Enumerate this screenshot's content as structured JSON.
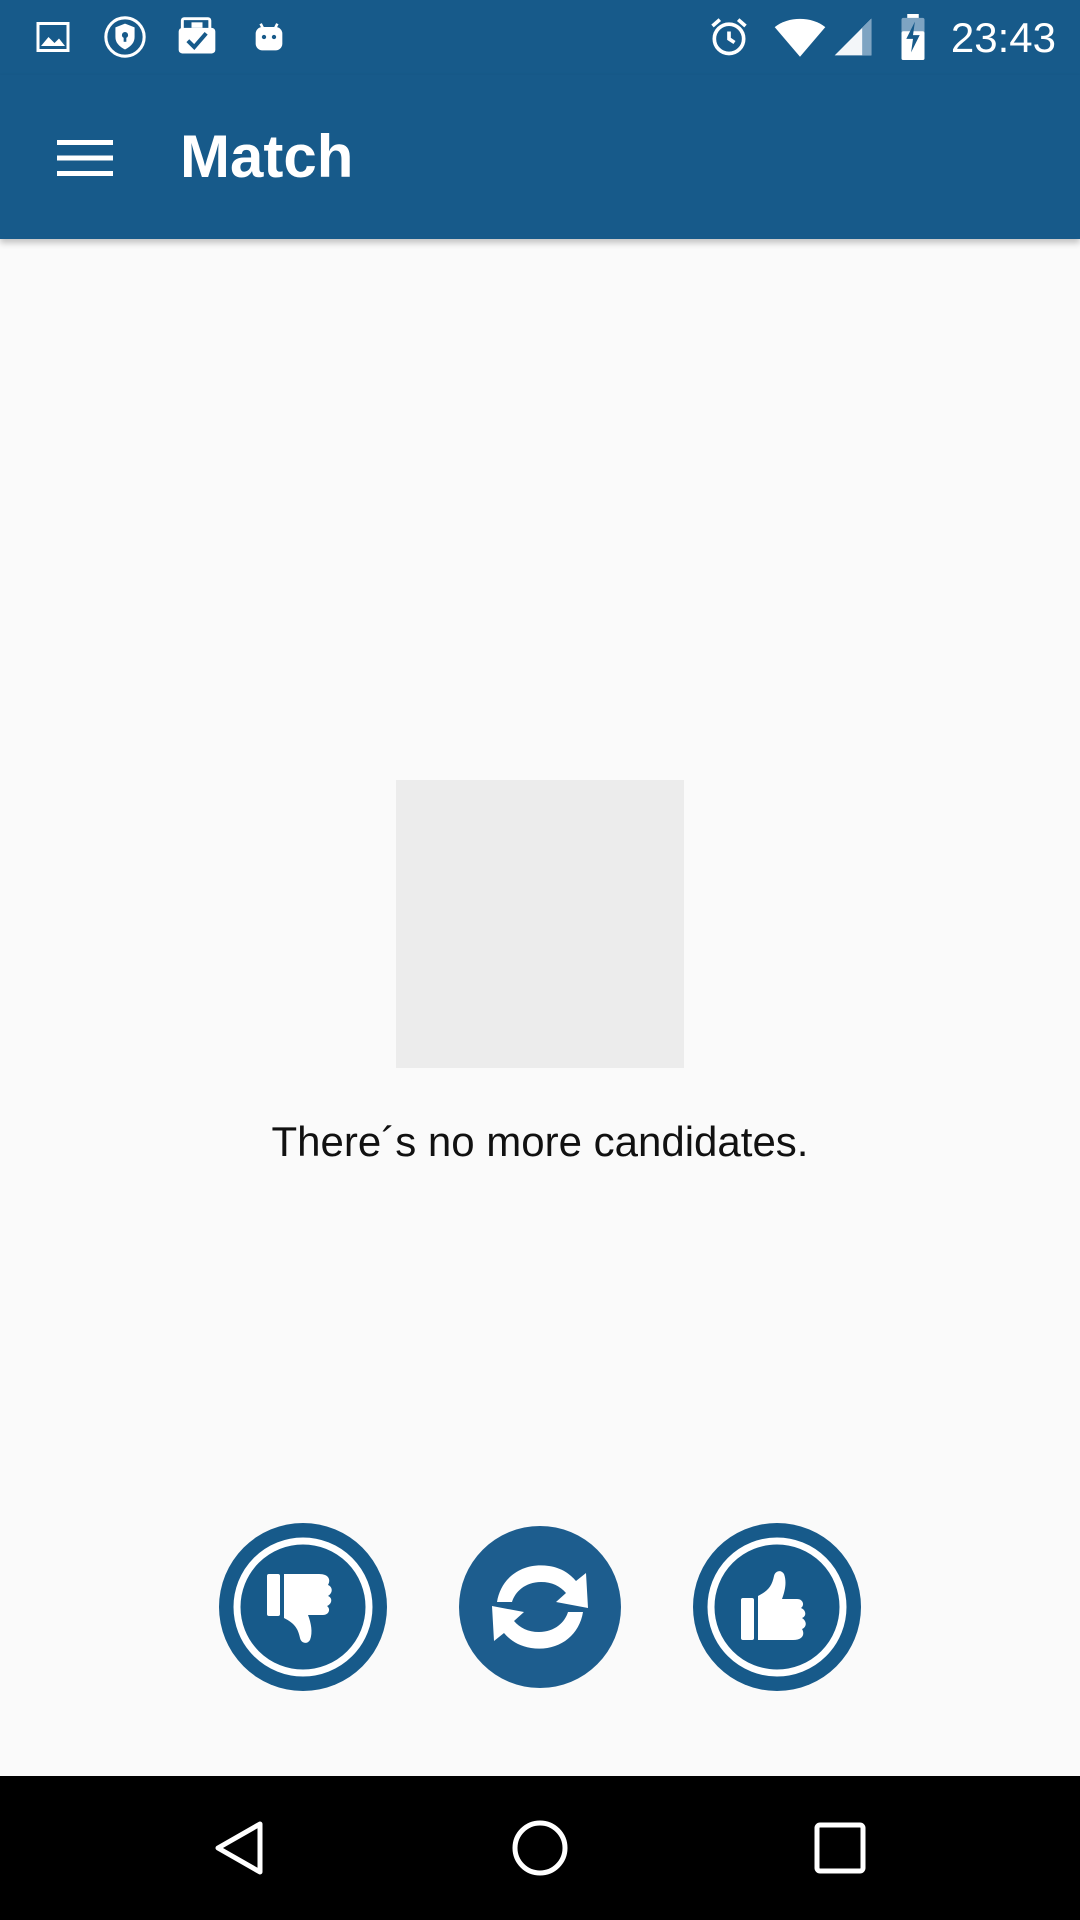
{
  "status_bar": {
    "time": "23:43",
    "left_icons": [
      "image-icon",
      "shield-icon",
      "briefcase-check-icon",
      "android-icon"
    ],
    "right_icons": [
      "alarm-icon",
      "wifi-icon",
      "signal-icon",
      "battery-charging-icon"
    ]
  },
  "app_bar": {
    "title": "Match",
    "menu_icon": "menu-icon"
  },
  "main": {
    "message": "There´s no more candidates."
  },
  "actions": [
    {
      "name": "dislike-button",
      "icon": "thumbs-down-icon"
    },
    {
      "name": "refresh-button",
      "icon": "refresh-icon"
    },
    {
      "name": "like-button",
      "icon": "thumbs-up-icon"
    }
  ],
  "nav": [
    "back-icon",
    "home-icon",
    "recents-icon"
  ],
  "colors": {
    "primary": "#175a8a",
    "background": "#fafafa",
    "placeholder": "#ececec",
    "nav_bar": "#000000"
  }
}
